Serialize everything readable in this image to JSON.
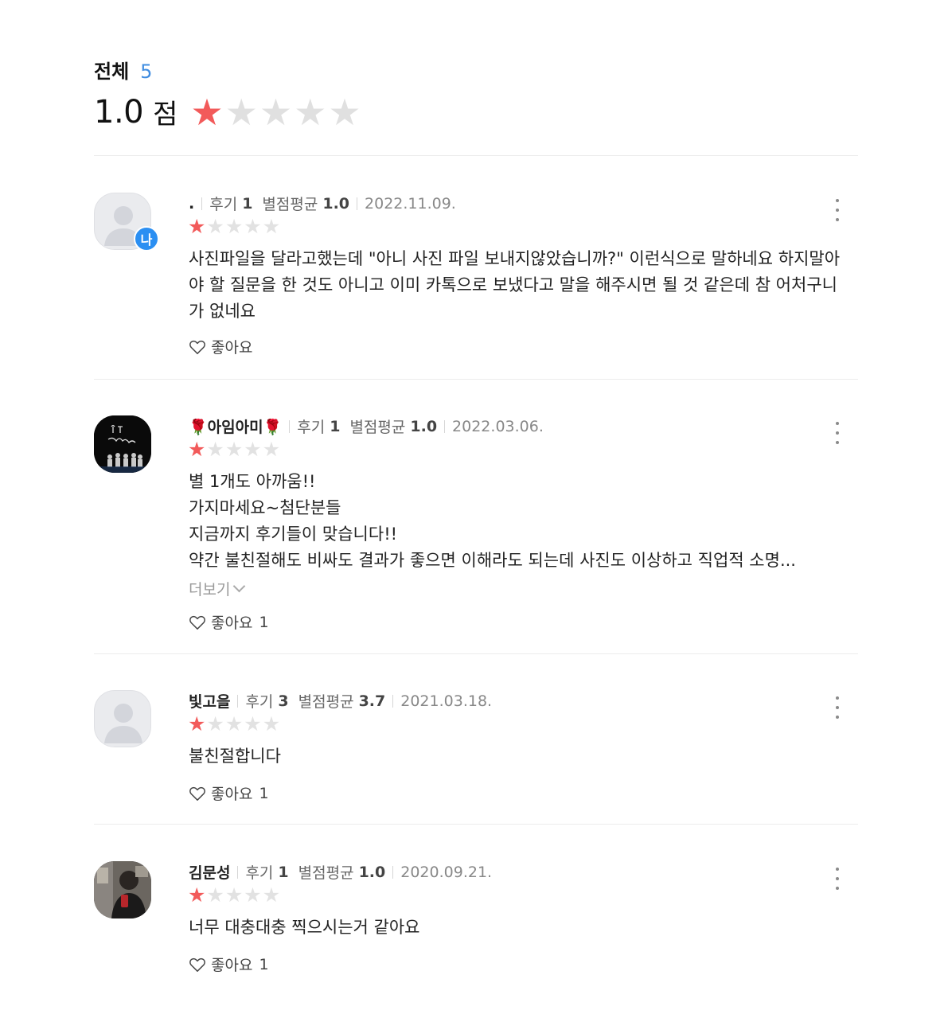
{
  "summary": {
    "title": "전체",
    "count": "5",
    "score": "1.0",
    "unit": "점",
    "rating": 1,
    "max_rating": 5,
    "star_color": "#f25a5a",
    "accent_color": "#3f8ce0"
  },
  "reviews": [
    {
      "name": ".",
      "avatar": "default-avatar",
      "me_badge": "나",
      "review_label": "후기",
      "review_count": "1",
      "avg_label": "별점평균",
      "avg_value": "1.0",
      "date": "2022.11.09.",
      "rating": 1,
      "text": "사진파일을 달라고했는데 \"아니 사진 파일 보내지않았습니까?\" 이런식으로 말하네요 하지말아야 할 질문을 한 것도 아니고  이미 카톡으로 보냈다고 말을 해주시면 될 것 같은데 참 어처구니가 없네요",
      "like_label": "좋아요",
      "like_count": ""
    },
    {
      "name": "🌹아임아미🌹",
      "avatar": "photo-avatar",
      "review_label": "후기",
      "review_count": "1",
      "avg_label": "별점평균",
      "avg_value": "1.0",
      "date": "2022.03.06.",
      "rating": 1,
      "text": "별 1개도 아까움!!\n가지마세요~첨단분들\n지금까지 후기들이 맞습니다!!\n약간 불친절해도 비싸도 결과가 좋으면 이해라도 되는데 사진도 이상하고 직업적 소명...",
      "more_label": "더보기",
      "like_label": "좋아요",
      "like_count": "1"
    },
    {
      "name": "빛고을",
      "avatar": "default-avatar",
      "review_label": "후기",
      "review_count": "3",
      "avg_label": "별점평균",
      "avg_value": "3.7",
      "date": "2021.03.18.",
      "rating": 1,
      "text": "불친절합니다",
      "like_label": "좋아요",
      "like_count": "1"
    },
    {
      "name": "김문성",
      "avatar": "photo-avatar",
      "review_label": "후기",
      "review_count": "1",
      "avg_label": "별점평균",
      "avg_value": "1.0",
      "date": "2020.09.21.",
      "rating": 1,
      "text": "너무 대충대충 찍으시는거 같아요",
      "like_label": "좋아요",
      "like_count": "1"
    }
  ]
}
